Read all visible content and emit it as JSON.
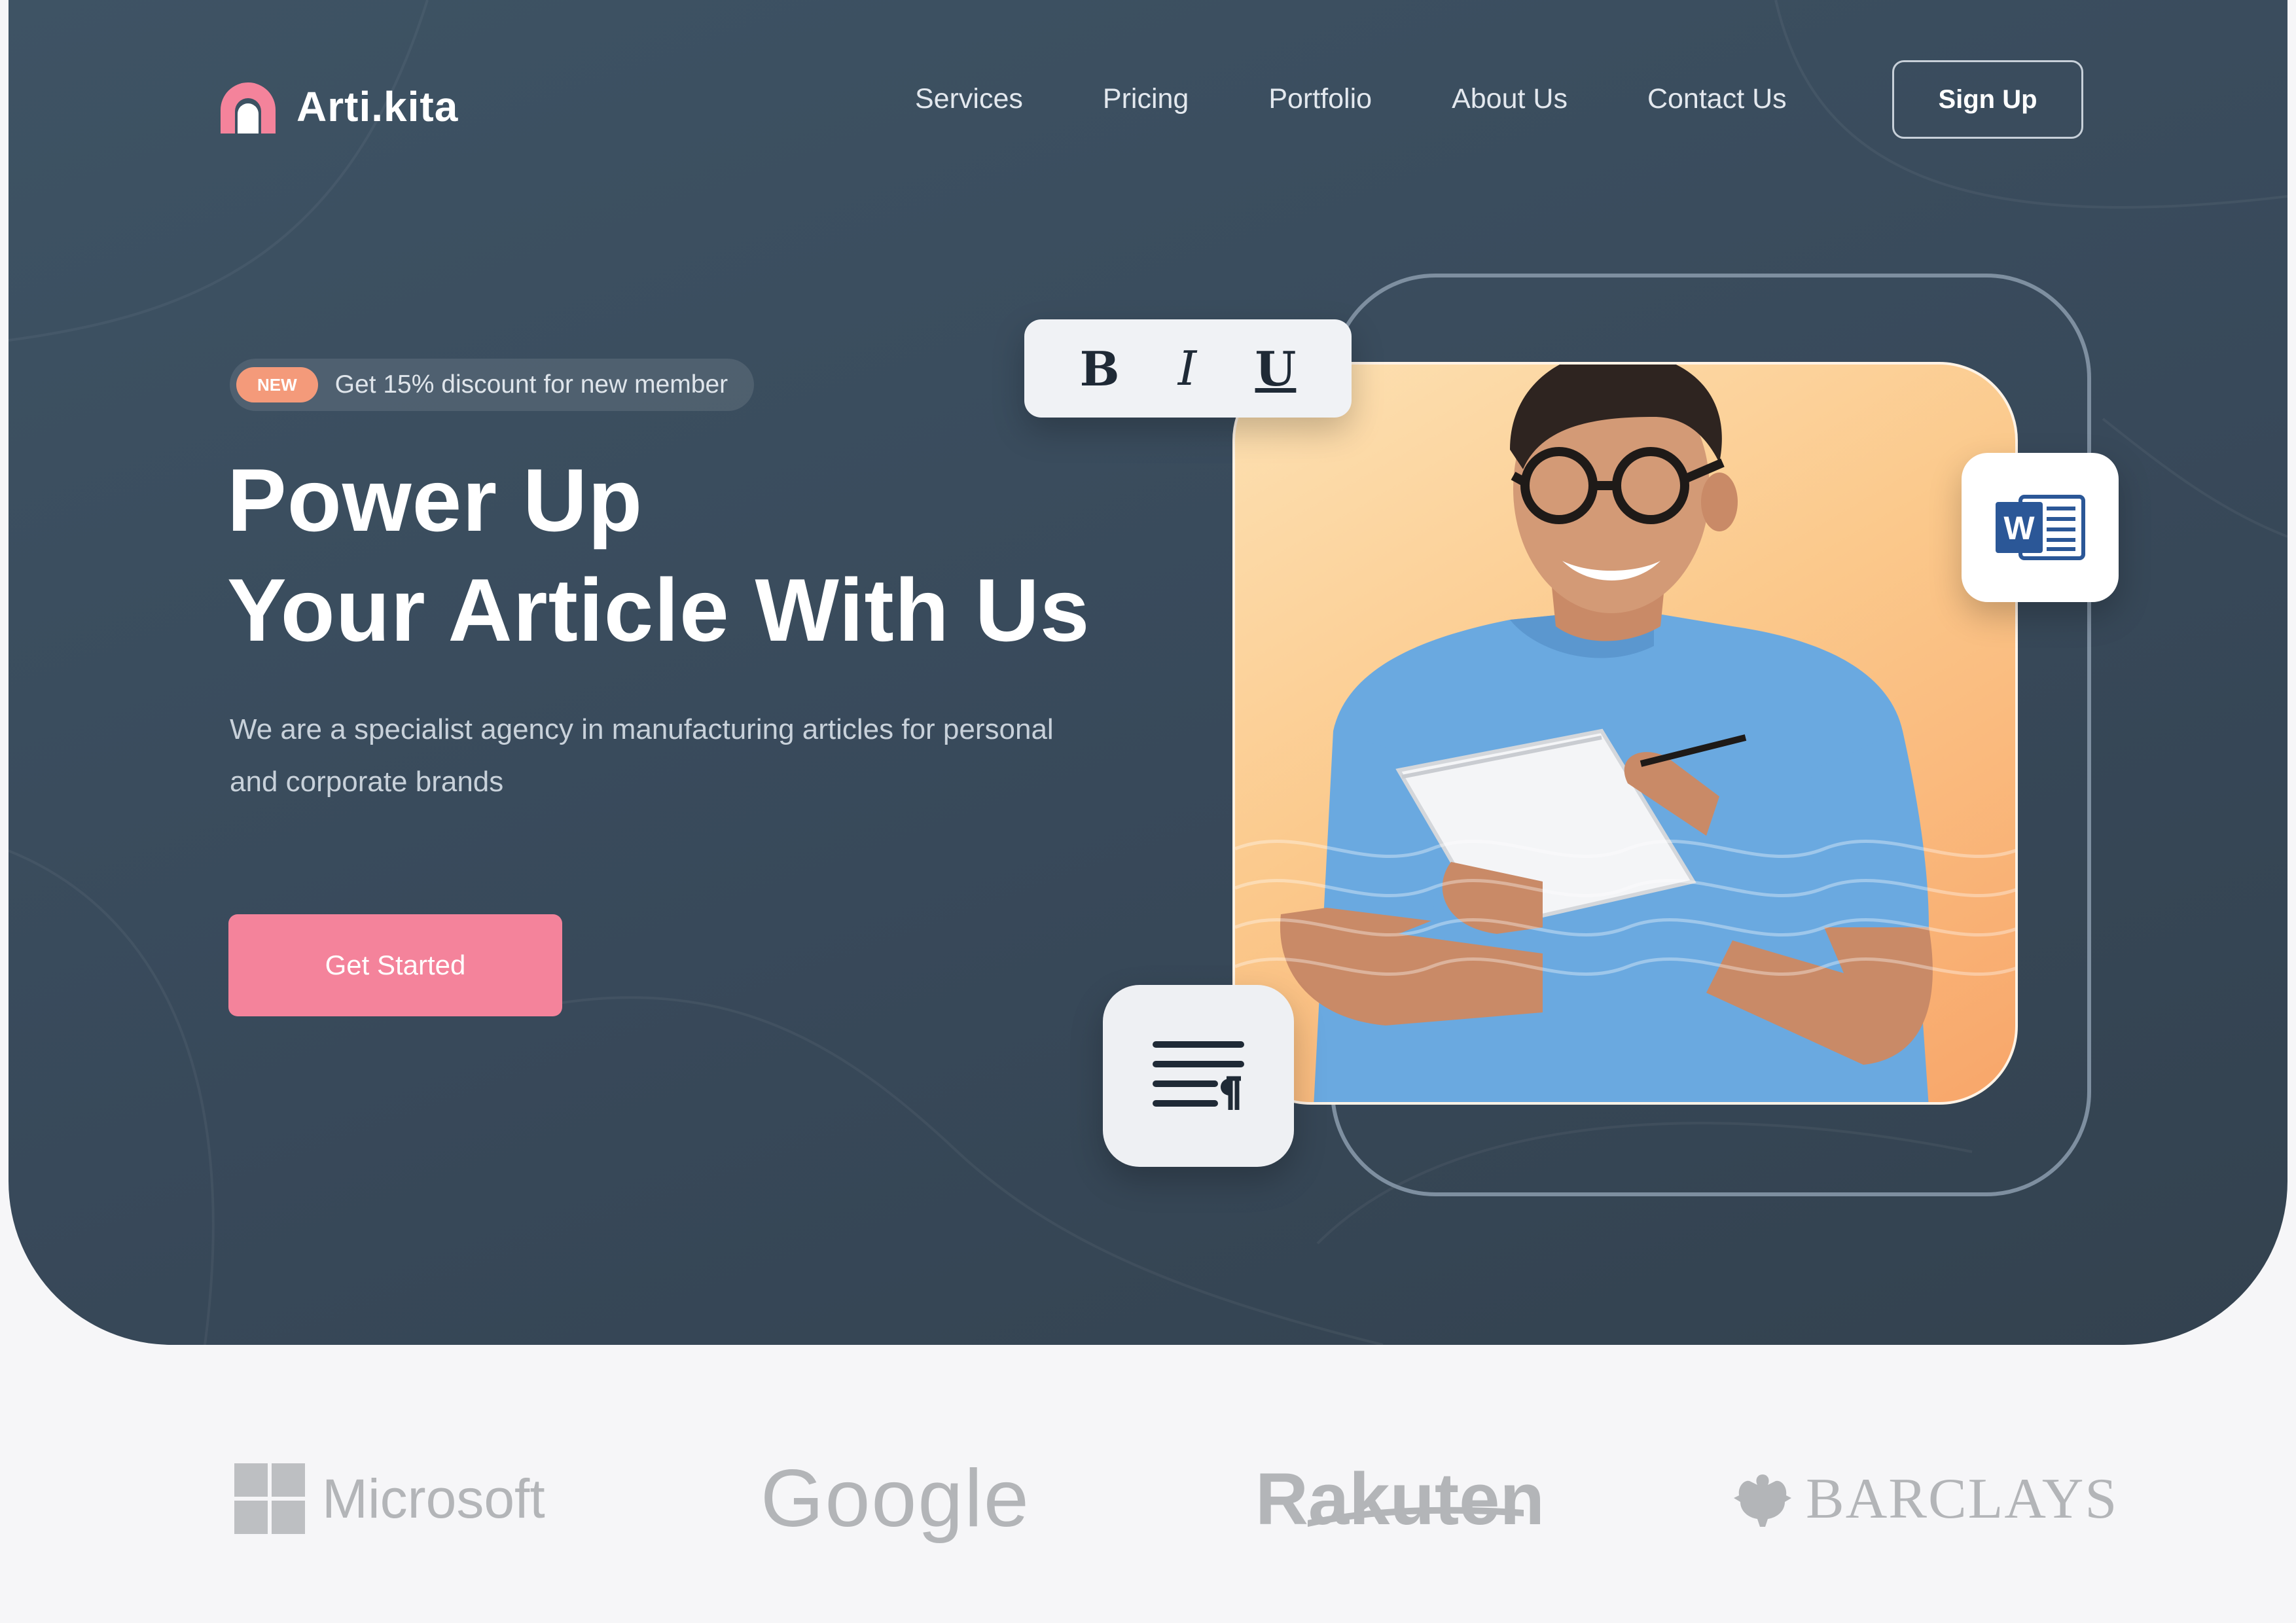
{
  "brand": {
    "name": "Arti.kita",
    "accent_color": "#f4839b",
    "hero_bg_color": "#3a4b5c"
  },
  "nav": {
    "items": [
      {
        "label": "Services"
      },
      {
        "label": "Pricing"
      },
      {
        "label": "Portfolio"
      },
      {
        "label": "About Us"
      },
      {
        "label": "Contact Us"
      }
    ],
    "signup_label": "Sign Up"
  },
  "hero": {
    "promo_badge": "NEW",
    "promo_text": "Get 15% discount for new member",
    "headline_line1": "Power Up",
    "headline_line2": "Your Article With Us",
    "subtext": "We are a specialist agency in manufacturing articles for personal and corporate brands",
    "cta_label": "Get Started",
    "format_toolbar": [
      "B",
      "I",
      "U"
    ],
    "word_icon_letter": "W"
  },
  "icons": {
    "logo": "arch-logo-icon",
    "bold": "bold-format-icon",
    "italic": "italic-format-icon",
    "underline": "underline-format-icon",
    "word": "microsoft-word-icon",
    "paragraph": "paragraph-align-icon"
  },
  "partners": [
    {
      "name": "Microsoft"
    },
    {
      "name": "Google"
    },
    {
      "name": "Rakuten"
    },
    {
      "name": "BARCLAYS"
    }
  ]
}
